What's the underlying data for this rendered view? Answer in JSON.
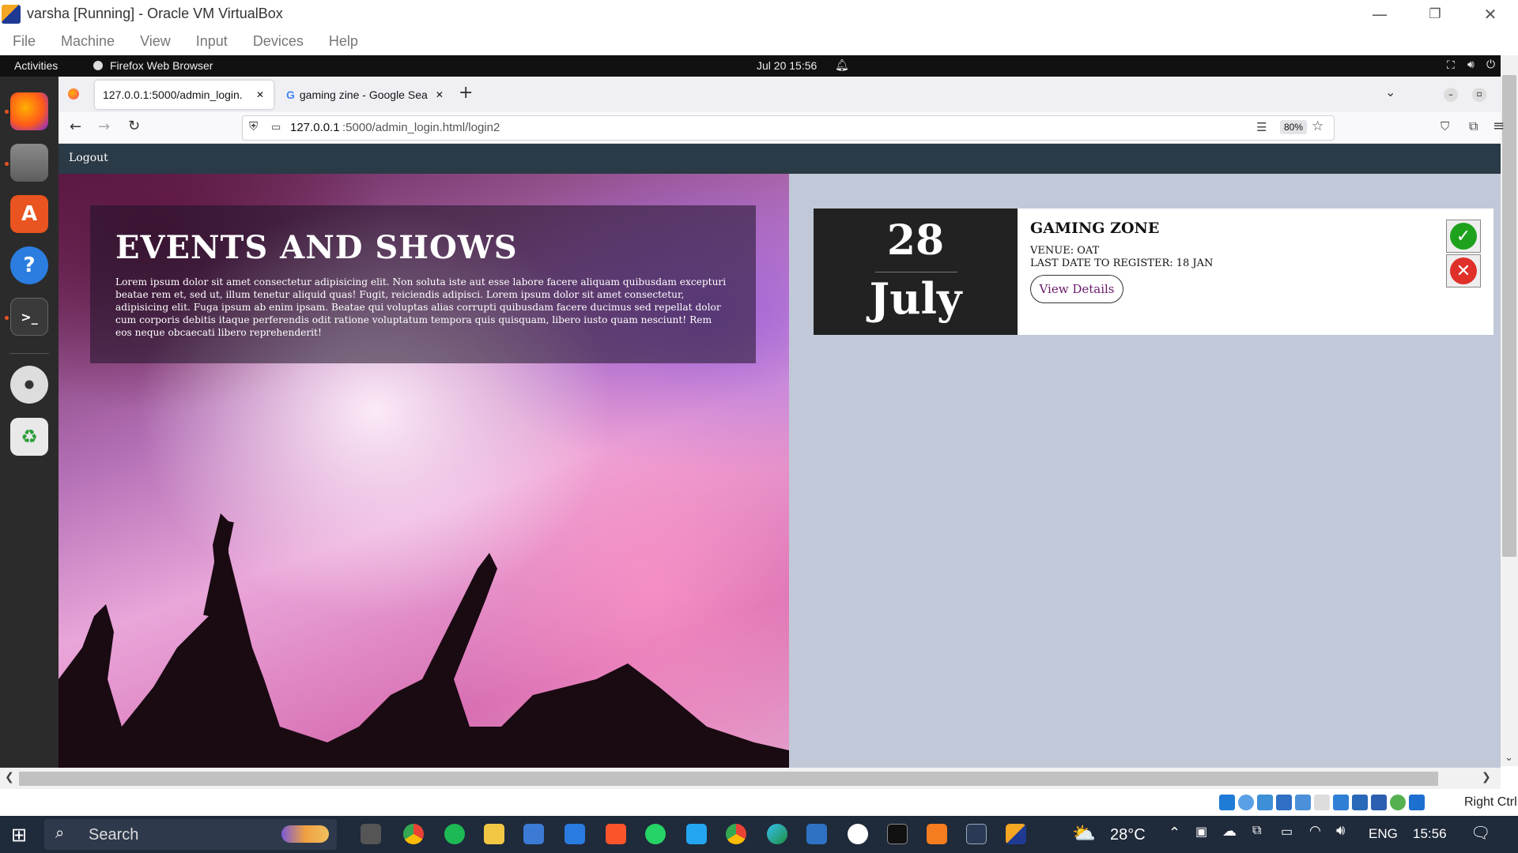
{
  "host_window": {
    "title": "varsha [Running] - Oracle VM VirtualBox",
    "menu": [
      "File",
      "Machine",
      "View",
      "Input",
      "Devices",
      "Help"
    ],
    "controls": {
      "minimize": "—",
      "restore": "❐",
      "close": "✕"
    }
  },
  "gnome_bar": {
    "activities": "Activities",
    "app_name": "Firefox Web Browser",
    "clock": "Jul 20  15:56"
  },
  "dock": {
    "items": [
      "firefox-icon",
      "files-icon",
      "app-center-icon",
      "help-icon",
      "terminal-icon",
      "disc-icon",
      "trash-icon"
    ]
  },
  "browser": {
    "tabs": [
      {
        "label": "127.0.0.1:5000/admin_login.",
        "active": true
      },
      {
        "label": "gaming zine - Google Sea",
        "active": false
      }
    ],
    "new_tab": "+",
    "url_host": "127.0.0.1",
    "url_path": ":5000/admin_login.html/login2",
    "zoom": "80%"
  },
  "site": {
    "nav": {
      "logout": "Logout"
    },
    "hero": {
      "title": "EVENTS AND SHOWS",
      "text": "Lorem ipsum dolor sit amet consectetur adipisicing elit. Non soluta iste aut esse labore facere aliquam quibusdam excepturi beatae rem et, sed ut, illum tenetur aliquid quas! Fugit, reiciendis adipisci. Lorem ipsum dolor sit amet consectetur, adipisicing elit. Fuga ipsum ab enim ipsam. Beatae qui voluptas alias corrupti quibusdam facere ducimus sed repellat dolor cum corporis debitis itaque perferendis odit ratione voluptatum tempora quis quisquam, libero iusto quam nesciunt! Rem eos neque obcaecati libero reprehenderit!"
    },
    "event": {
      "day": "28",
      "month": "July",
      "title": "GAMING ZONE",
      "venue": "VENUE: OAT",
      "last_date": "LAST DATE TO REGISTER: 18 JAN",
      "view_details": "View Details",
      "approve_symbol": "✓",
      "reject_symbol": "✕"
    }
  },
  "vm_status": {
    "host_key": "Right Ctrl"
  },
  "taskbar": {
    "search": "Search",
    "weather": "28°C",
    "language": "ENG",
    "time": "15:56"
  },
  "colors": {
    "site_nav": "#2a3a46",
    "page_bg": "#c1c9d8",
    "date_box": "#222222",
    "approve": "#1ea21e",
    "reject": "#e0302a"
  }
}
